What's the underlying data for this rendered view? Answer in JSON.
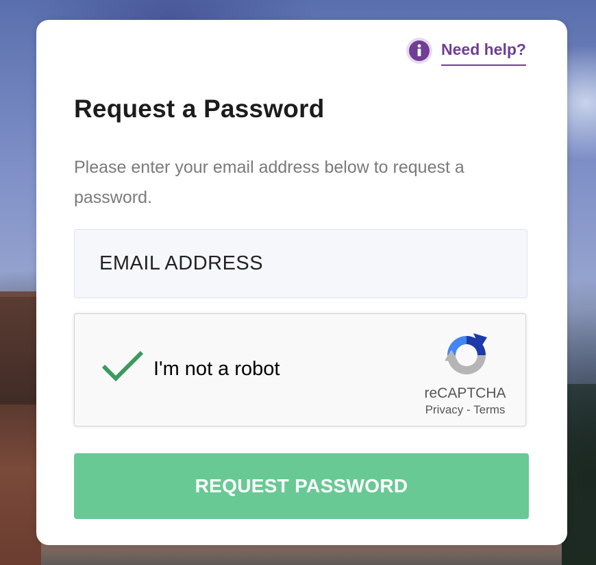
{
  "help": {
    "label": "Need help?",
    "icon": "info-icon"
  },
  "form": {
    "title": "Request a Password",
    "subtitle": "Please enter your email address below to request a password.",
    "email_placeholder": "EMAIL ADDRESS",
    "email_value": "",
    "submit_label": "REQUEST PASSWORD"
  },
  "recaptcha": {
    "label": "I'm not a robot",
    "checked": true,
    "brand": "reCAPTCHA",
    "privacy": "Privacy",
    "separator": "-",
    "terms": "Terms"
  },
  "colors": {
    "accent_purple": "#6f3e95",
    "button_green": "#68c994",
    "check_green": "#3c9a5f"
  }
}
